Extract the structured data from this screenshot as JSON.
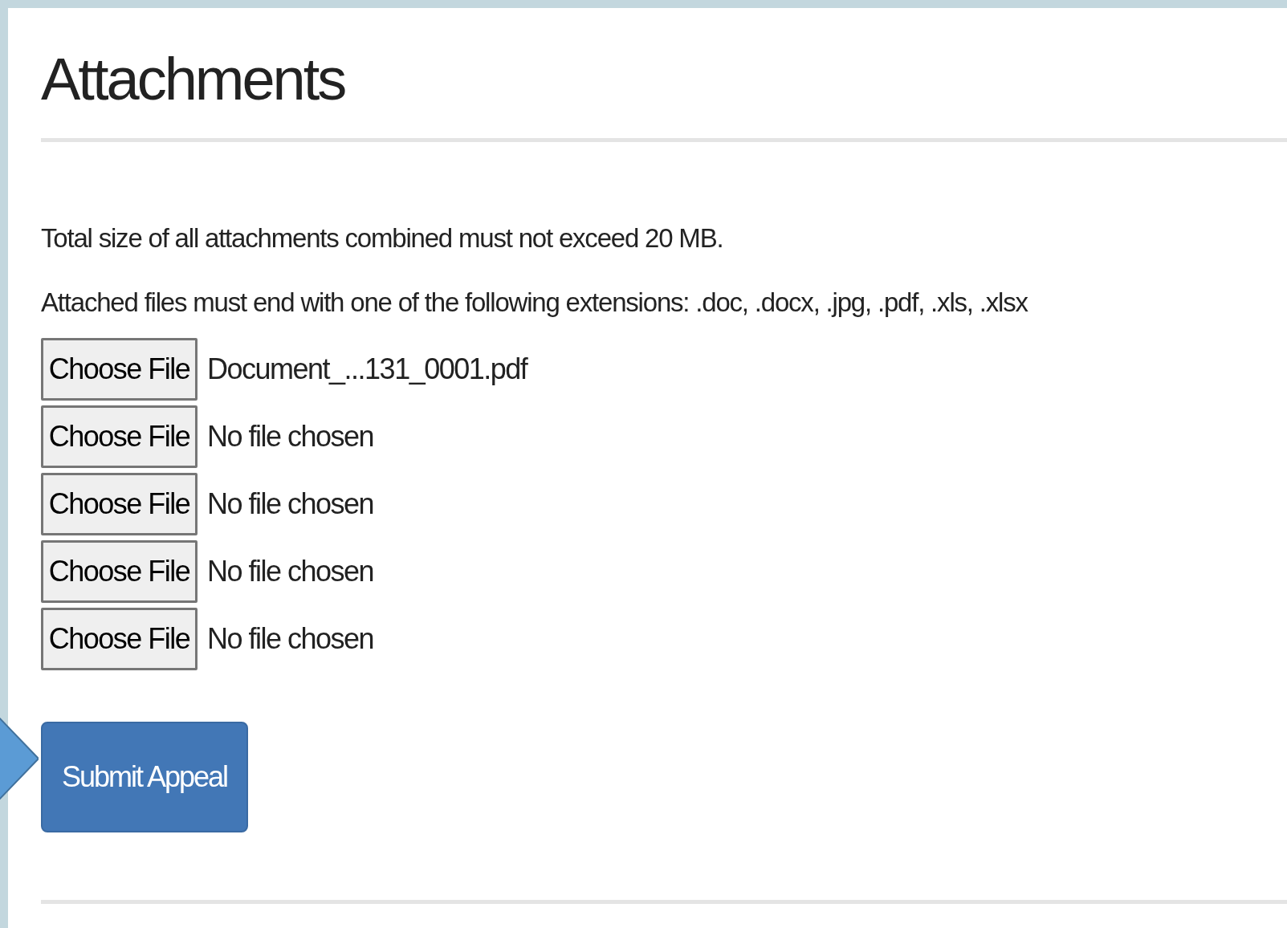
{
  "heading": "Attachments",
  "notes": [
    "Total size of all attachments combined must not exceed 20 MB.",
    "Attached files must end with one of the following extensions: .doc, .docx, .jpg, .pdf, .xls, .xlsx"
  ],
  "files": [
    {
      "button": "Choose File",
      "filename": "Document_...131_0001.pdf"
    },
    {
      "button": "Choose File",
      "filename": "No file chosen"
    },
    {
      "button": "Choose File",
      "filename": "No file chosen"
    },
    {
      "button": "Choose File",
      "filename": "No file chosen"
    },
    {
      "button": "Choose File",
      "filename": "No file chosen"
    }
  ],
  "submit_button": "Submit Appeal"
}
